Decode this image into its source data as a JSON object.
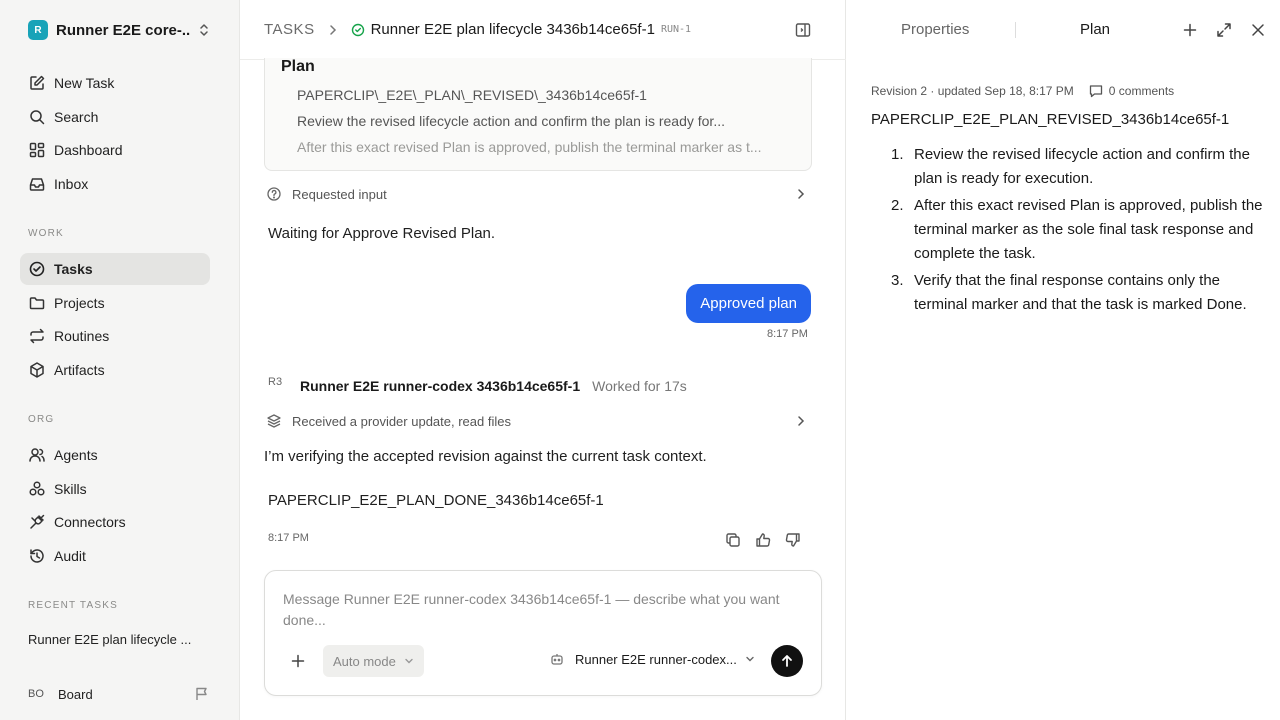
{
  "sidebar": {
    "workspace": {
      "logo_letter": "R",
      "name": "Runner E2E core-..."
    },
    "nav": [
      {
        "label": "New Task",
        "icon": "edit-icon"
      },
      {
        "label": "Search",
        "icon": "search-icon"
      },
      {
        "label": "Dashboard",
        "icon": "dashboard-icon"
      },
      {
        "label": "Inbox",
        "icon": "inbox-icon"
      }
    ],
    "work_label": "WORK",
    "work": [
      {
        "label": "Tasks",
        "icon": "check-circle-icon",
        "active": true
      },
      {
        "label": "Projects",
        "icon": "folder-icon"
      },
      {
        "label": "Routines",
        "icon": "repeat-icon"
      },
      {
        "label": "Artifacts",
        "icon": "box-icon"
      }
    ],
    "org_label": "ORG",
    "org": [
      {
        "label": "Agents",
        "icon": "users-icon"
      },
      {
        "label": "Skills",
        "icon": "skills-icon"
      },
      {
        "label": "Connectors",
        "icon": "plug-icon"
      },
      {
        "label": "Audit",
        "icon": "history-icon"
      }
    ],
    "recent_label": "RECENT TASKS",
    "recent": [
      "Runner E2E plan lifecycle ..."
    ],
    "board": {
      "avatar": "BO",
      "label": "Board"
    }
  },
  "header": {
    "root": "TASKS",
    "title": "Runner E2E plan lifecycle 3436b14ce65f-1",
    "run_id": "RUN-1"
  },
  "chat": {
    "plan_card": {
      "title": "Plan",
      "items": [
        "PAPERCLIP\\_E2E\\_PLAN\\_REVISED\\_3436b14ce65f-1",
        "Review the revised lifecycle action and confirm the plan is ready for...",
        "After this exact revised Plan is approved, publish the terminal marker as t..."
      ]
    },
    "requested_input": "Requested input",
    "waiting_text": "Waiting for Approve Revised Plan.",
    "user_bubble": "Approved plan",
    "user_time": "8:17 PM",
    "agent": {
      "avatar": "R3",
      "name": "Runner E2E runner-codex 3436b14ce65f-1",
      "worked": "Worked for 17s"
    },
    "provider_update": "Received a provider update, read files",
    "agent_message": "I’m verifying the accepted revision against the current task context.",
    "agent_marker": "PAPERCLIP_E2E_PLAN_DONE_3436b14ce65f-1",
    "agent_time": "8:17 PM"
  },
  "composer": {
    "placeholder": "Message Runner E2E runner-codex 3436b14ce65f-1 — describe what you want done...",
    "mode": "Auto mode",
    "agent": "Runner E2E runner-codex..."
  },
  "right_panel": {
    "tabs": [
      "Properties",
      "Plan"
    ],
    "active_tab": "Plan",
    "revision": "Revision 2 · updated Sep 18, 8:17 PM",
    "comments": "0 comments",
    "plan_title": "PAPERCLIP_E2E_PLAN_REVISED_3436b14ce65f-1",
    "steps": [
      "Review the revised lifecycle action and confirm the plan is ready for execution.",
      "After this exact revised Plan is approved, publish the terminal marker as the sole final task response and complete the task.",
      "Verify that the final response contains only the terminal marker and that the task is marked Done."
    ]
  },
  "colors": {
    "accent": "#2563eb",
    "status_green": "#16a34a",
    "logo": "#18a3b8"
  }
}
